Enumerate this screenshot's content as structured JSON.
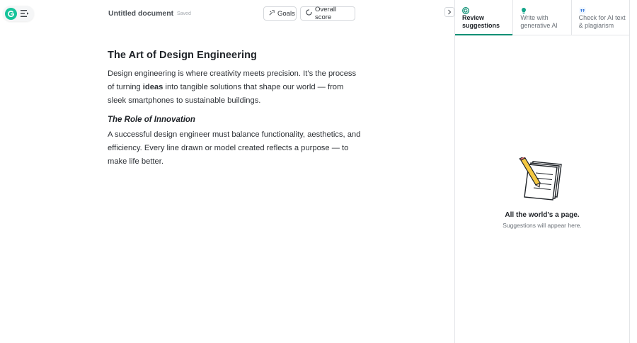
{
  "app": {
    "logo_color": "#15c39a",
    "accent_color": "#0e8f74"
  },
  "header": {
    "doc_title": "Untitled document",
    "save_status": "Saved",
    "goals_label": "Goals",
    "score_label": "Overall score"
  },
  "document": {
    "title": "The Art of Design Engineering",
    "p1_before": "Design engineering is where creativity meets precision. It’s the process of turning ",
    "p1_bold": "ideas",
    "p1_after": " into tangible solutions that shape our world — from sleek smartphones to sustainable buildings.",
    "subheading": "The Role of Innovation",
    "p2": "A successful design engineer must balance functionality, aesthetics, and efficiency. Every line drawn or model created reflects a purpose — to make life better."
  },
  "sidebar": {
    "tabs": [
      {
        "label": "Review suggestions",
        "icon": "grammarly-icon",
        "active": true
      },
      {
        "label": "Write with generative AI",
        "icon": "lightbulb-icon",
        "active": false
      },
      {
        "label": "Check for AI text & plagiarism",
        "icon": "quote-icon",
        "active": false
      }
    ],
    "empty_title": "All the world's a page.",
    "empty_subtitle": "Suggestions will appear here."
  }
}
